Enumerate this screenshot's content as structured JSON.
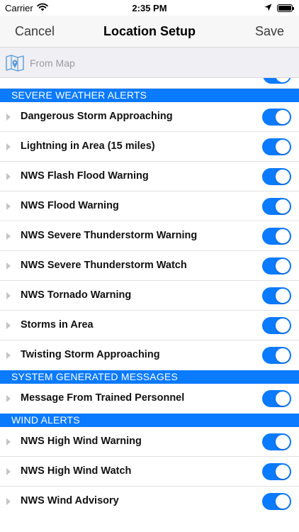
{
  "status_bar": {
    "carrier": "Carrier",
    "time": "2:35 PM",
    "icons": [
      "wifi-icon",
      "location-arrow-icon",
      "battery-icon"
    ]
  },
  "nav": {
    "cancel_label": "Cancel",
    "title": "Location Setup",
    "save_label": "Save"
  },
  "map_bar": {
    "icon": "map-pin-icon",
    "label": "From Map"
  },
  "colors": {
    "accent": "#0a7aff",
    "section_text": "#ffffff",
    "disclosure": "#c4c4c9"
  },
  "sections": [
    {
      "title": "SEVERE WEATHER ALERTS",
      "items": [
        {
          "label": "Dangerous Storm Approaching",
          "enabled": true
        },
        {
          "label": "Lightning in Area (15 miles)",
          "enabled": true
        },
        {
          "label": "NWS Flash Flood Warning",
          "enabled": true
        },
        {
          "label": "NWS Flood Warning",
          "enabled": true
        },
        {
          "label": "NWS Severe Thunderstorm Warning",
          "enabled": true
        },
        {
          "label": "NWS Severe Thunderstorm Watch",
          "enabled": true
        },
        {
          "label": "NWS Tornado Warning",
          "enabled": true
        },
        {
          "label": "Storms in Area",
          "enabled": true
        },
        {
          "label": "Twisting Storm Approaching",
          "enabled": true
        }
      ]
    },
    {
      "title": "SYSTEM GENERATED MESSAGES",
      "items": [
        {
          "label": "Message From Trained Personnel",
          "enabled": true
        }
      ]
    },
    {
      "title": "WIND ALERTS",
      "items": [
        {
          "label": "NWS High Wind Warning",
          "enabled": true
        },
        {
          "label": "NWS High Wind Watch",
          "enabled": true
        },
        {
          "label": "NWS Wind Advisory",
          "enabled": true
        }
      ]
    }
  ]
}
